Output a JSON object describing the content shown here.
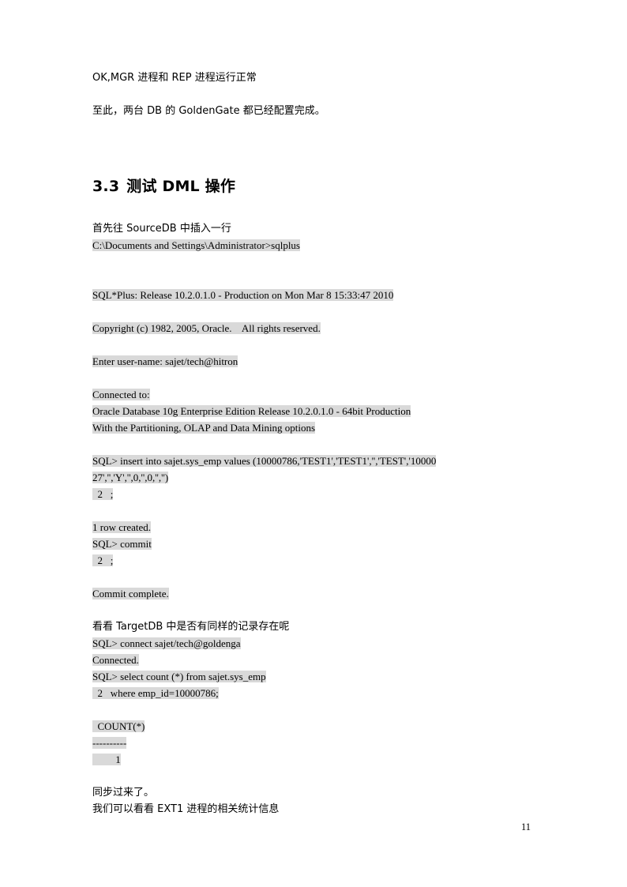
{
  "document": {
    "page_number": "11",
    "highlight_color": "#d9d9d9",
    "background_color": "#ffffff",
    "text_color": "#000000"
  },
  "intro": {
    "line1": "OK,MGR 进程和 REP 进程运行正常",
    "line2": "至此，两台 DB 的 GoldenGate 都已经配置完成。"
  },
  "section": {
    "number": "3.3",
    "title": "测试 DML 操作"
  },
  "body": {
    "insert_intro": "首先往 SourceDB 中插入一行",
    "check_target": "看看 TargetDB 中是否有同样的记录存在呢",
    "synced": "同步过来了。",
    "stats_intro": "我们可以看看 EXT1 进程的相关统计信息"
  },
  "console": {
    "prompt_sqlplus": "C:\\Documents and Settings\\Administrator>sqlplus",
    "banner_release": "SQL*Plus: Release 10.2.0.1.0 - Production on Mon Mar 8 15:33:47 2010",
    "copyright": "Copyright (c) 1982, 2005, Oracle.    All rights reserved.",
    "enter_user": "Enter user-name: sajet/tech@hitron",
    "connected_to": "Connected to:",
    "db_version": "Oracle Database 10g Enterprise Edition Release 10.2.0.1.0 - 64bit Production",
    "db_options": "With the Partitioning, OLAP and Data Mining options",
    "insert_stmt_part1": "SQL> insert into sajet.sys_emp values (10000786,'TEST1','TEST1','','TEST','10000",
    "insert_stmt_part2": "27','','Y','',0,'',0,'','')",
    "cont_prompt_1": "  2   ;",
    "row_created": "1 row created.",
    "commit_cmd": "SQL> commit",
    "cont_prompt_2": "  2   ;",
    "commit_complete": "Commit complete.",
    "connect_cmd": "SQL> connect sajet/tech@goldenga",
    "connected": "Connected.",
    "select_stmt": "SQL> select count (*) from sajet.sys_emp",
    "select_where": "  2   where emp_id=10000786;",
    "result_header": "  COUNT(*)",
    "result_rule": "----------",
    "result_value": "         1"
  }
}
